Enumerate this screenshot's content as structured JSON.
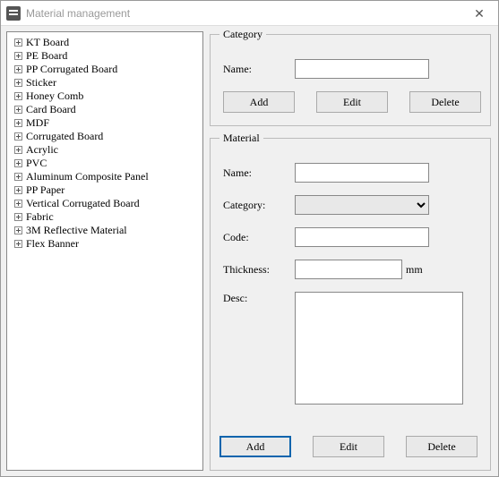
{
  "window": {
    "title": "Material management",
    "close_glyph": "✕"
  },
  "tree": {
    "items": [
      "KT Board",
      "PE Board",
      "PP Corrugated Board",
      "Sticker",
      "Honey Comb",
      "Card Board",
      "MDF",
      "Corrugated Board",
      "Acrylic",
      "PVC",
      "Aluminum Composite Panel",
      "PP Paper",
      "Vertical Corrugated Board",
      "Fabric",
      "3M Reflective Material",
      "Flex Banner"
    ]
  },
  "category": {
    "legend": "Category",
    "name_label": "Name:",
    "name_value": "",
    "add_label": "Add",
    "edit_label": "Edit",
    "delete_label": "Delete"
  },
  "material": {
    "legend": "Material",
    "name_label": "Name:",
    "name_value": "",
    "category_label": "Category:",
    "category_value": "",
    "code_label": "Code:",
    "code_value": "",
    "thickness_label": "Thickness:",
    "thickness_value": "",
    "thickness_unit": "mm",
    "desc_label": "Desc:",
    "desc_value": "",
    "add_label": "Add",
    "edit_label": "Edit",
    "delete_label": "Delete"
  }
}
